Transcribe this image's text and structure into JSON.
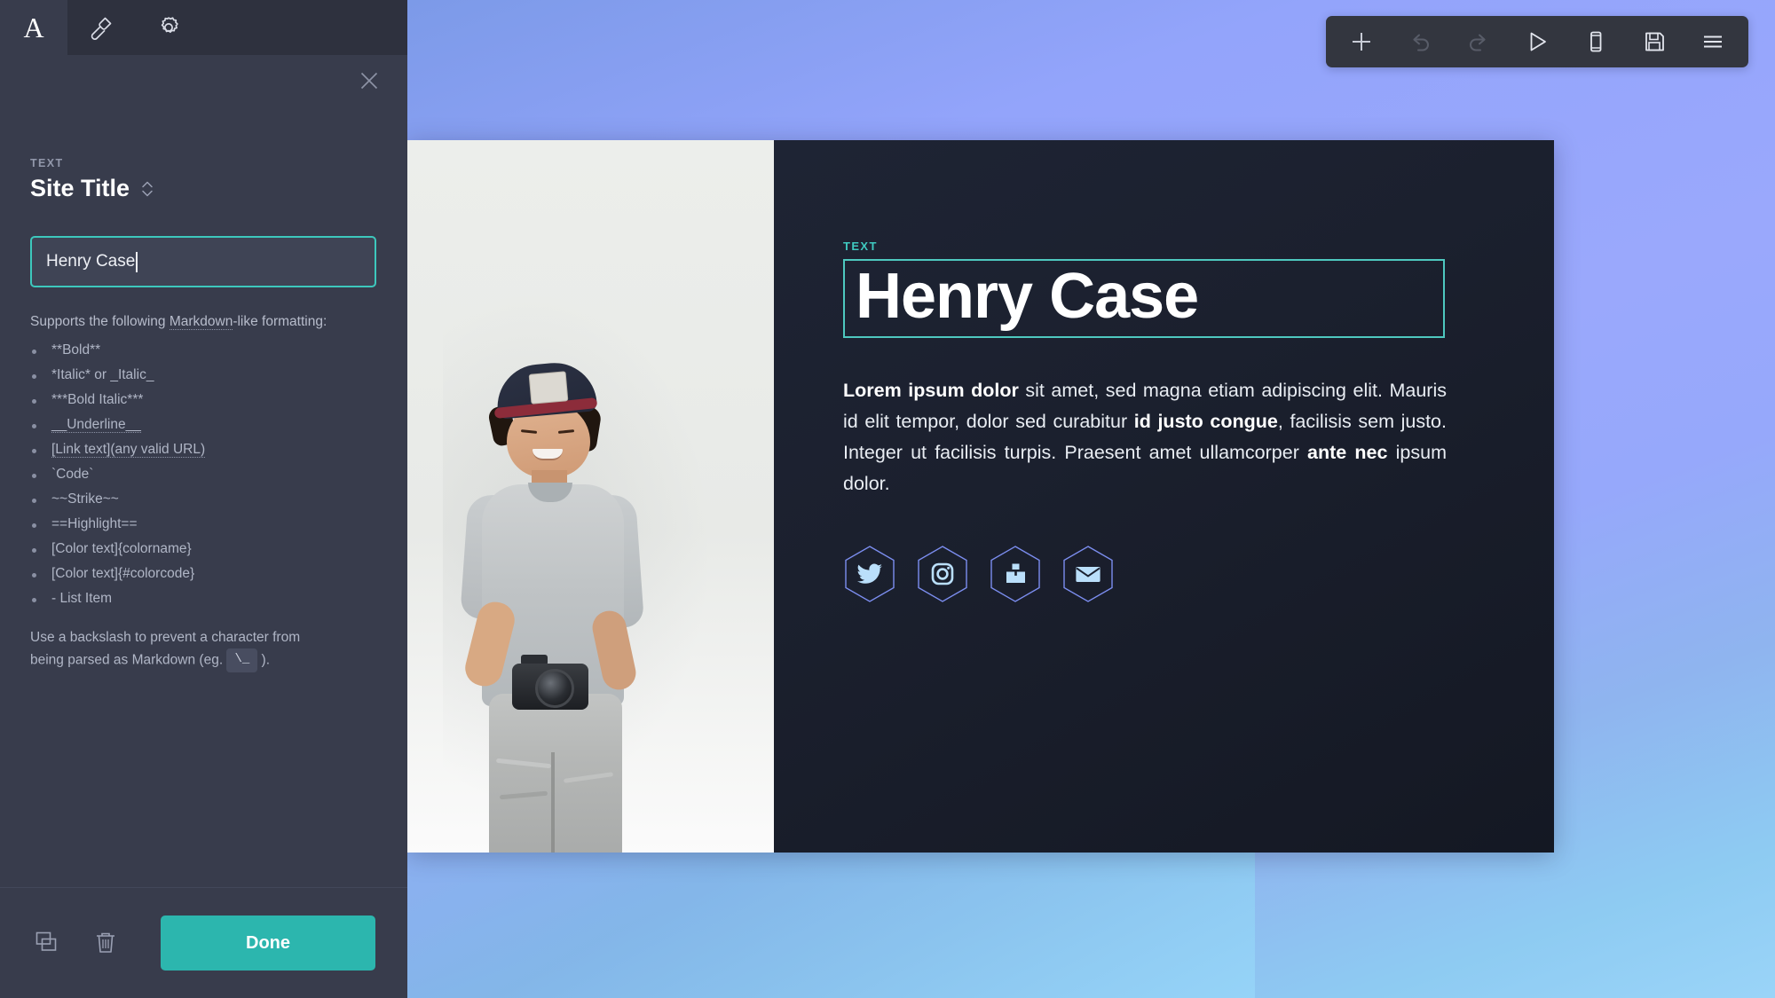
{
  "sidebar": {
    "tabs": [
      {
        "name": "content-tab",
        "icon": "letter-a-icon",
        "label": "A",
        "active": true
      },
      {
        "name": "style-tab",
        "icon": "paintbrush-icon",
        "label": "",
        "active": false
      },
      {
        "name": "settings-tab",
        "icon": "gear-icon",
        "label": "",
        "active": false
      }
    ],
    "close_label": "×",
    "section_kicker": "TEXT",
    "section_title": "Site Title",
    "input_value": "Henry Case",
    "help_intro_before": "Supports the following ",
    "help_intro_link": "Markdown",
    "help_intro_after": "-like formatting:",
    "markdown_items": [
      "**Bold**",
      "*Italic* or _Italic_",
      "***Bold Italic***",
      "__Underline__",
      "[Link text](any valid URL)",
      "`Code`",
      "~~Strike~~",
      "==Highlight==",
      "[Color text]{colorname}",
      "[Color text]{#colorcode}",
      "- List Item"
    ],
    "backslash_note_before": "Use a backslash to prevent a character from being parsed as Markdown (eg. ",
    "backslash_code": "\\_",
    "backslash_note_after": " ).",
    "footer": {
      "duplicate_icon": "duplicate-icon",
      "delete_icon": "trash-icon",
      "done_label": "Done"
    }
  },
  "toolbar": {
    "items": [
      {
        "name": "add-element-button",
        "icon": "plus-icon",
        "enabled": true
      },
      {
        "name": "undo-button",
        "icon": "undo-icon",
        "enabled": false
      },
      {
        "name": "redo-button",
        "icon": "redo-icon",
        "enabled": false
      },
      {
        "name": "preview-button",
        "icon": "play-icon",
        "enabled": true
      },
      {
        "name": "mobile-preview-button",
        "icon": "mobile-icon",
        "enabled": true
      },
      {
        "name": "save-button",
        "icon": "save-floppy-icon",
        "enabled": true
      },
      {
        "name": "menu-button",
        "icon": "hamburger-menu-icon",
        "enabled": true
      }
    ]
  },
  "canvas": {
    "selection_label": "TEXT",
    "headline": "Henry Case",
    "body_copy": [
      {
        "text": "Lorem ipsum dolor",
        "bold": true
      },
      {
        "text": " sit amet, sed magna etiam adipiscing elit. Mauris id elit tempor, dolor sed curabitur ",
        "bold": false
      },
      {
        "text": "id justo congue",
        "bold": true
      },
      {
        "text": ", facilisis sem justo. Integer ut facilisis turpis. Praesent amet ullamcorper ",
        "bold": false
      },
      {
        "text": "ante nec",
        "bold": true
      },
      {
        "text": " ipsum dolor.",
        "bold": false
      }
    ],
    "social_icons": [
      {
        "name": "twitter-icon",
        "label": "Twitter"
      },
      {
        "name": "instagram-icon",
        "label": "Instagram"
      },
      {
        "name": "dribbble-icon",
        "label": "Portfolio"
      },
      {
        "name": "email-icon",
        "label": "Email"
      }
    ],
    "photo_alt": "Smiling man in cap holding a camera"
  },
  "colors": {
    "accent_teal": "#3dc8bd",
    "done_button": "#2cb6ae",
    "sidebar_bg": "#383c4c",
    "tabbar_bg": "#2e313e",
    "canvas_panel_bg": "#1b202e",
    "background_blue": "#93a4fb",
    "social_icon_blue": "#b7dffb"
  }
}
